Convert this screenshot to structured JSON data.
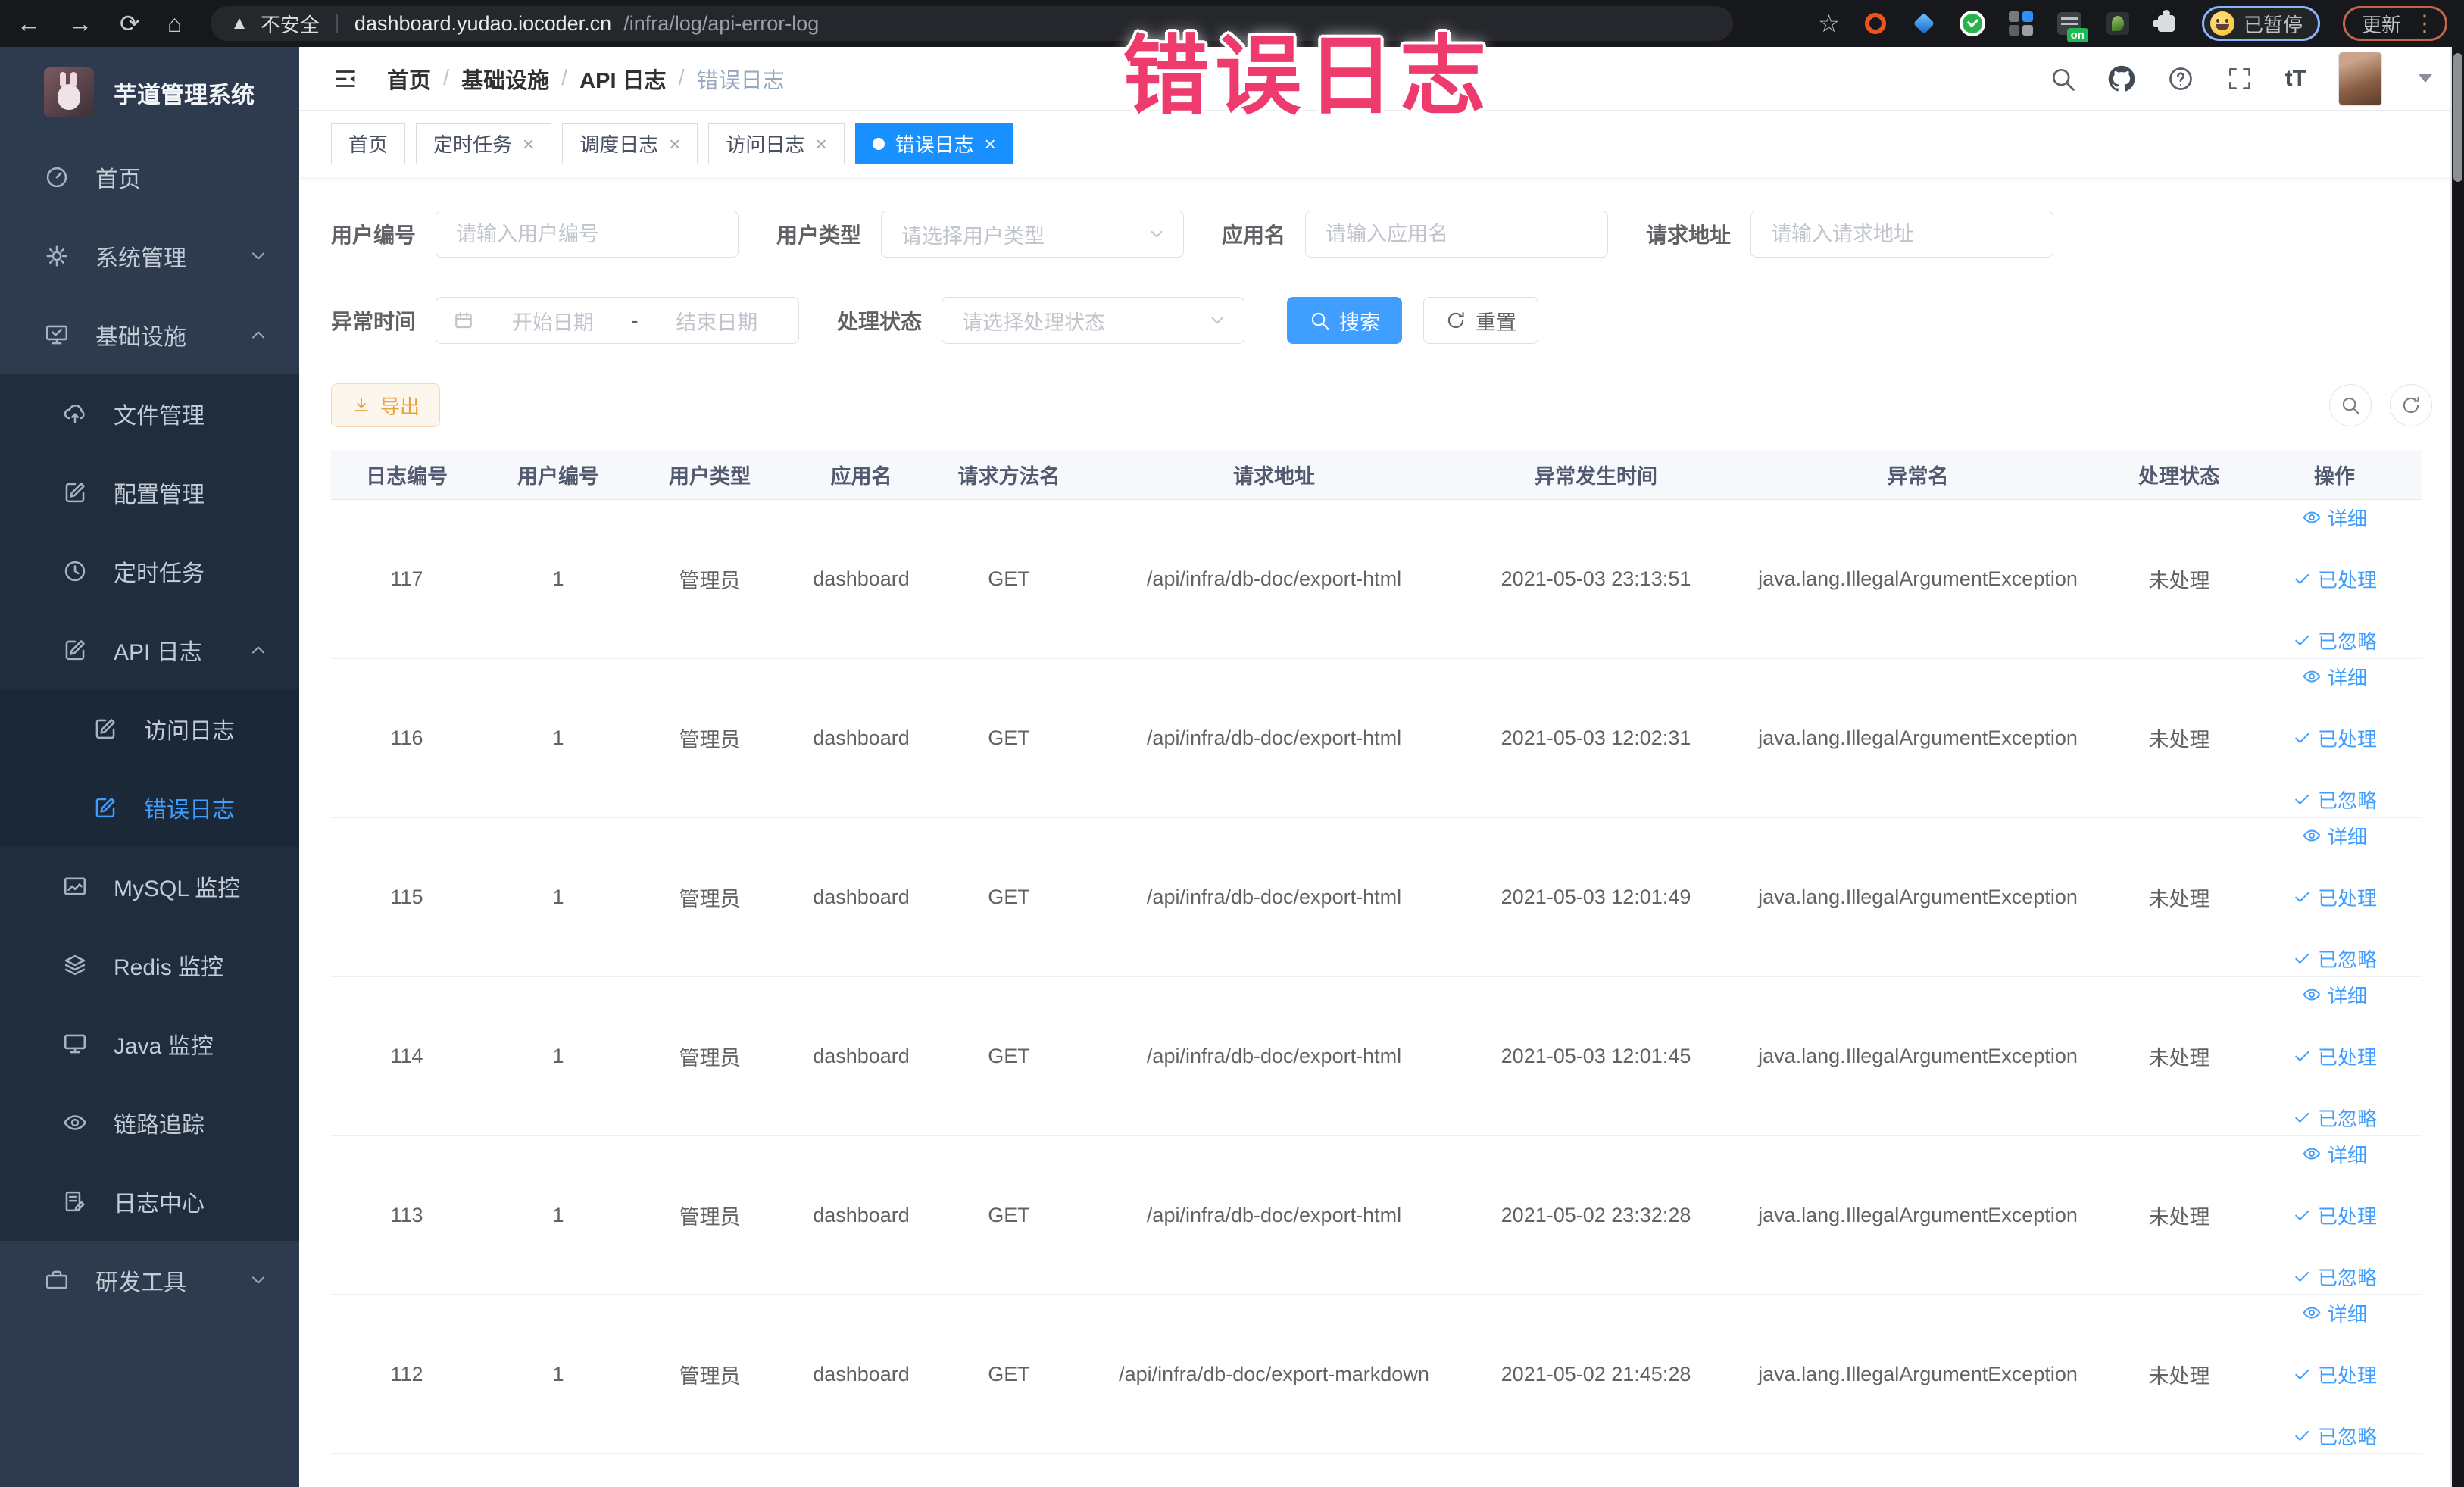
{
  "browser": {
    "security_label": "不安全",
    "url_host": "dashboard.yudao.iocoder.cn",
    "url_path": "/infra/log/api-error-log",
    "on_badge_label": "on",
    "paused_label": "已暂停",
    "update_label": "更新"
  },
  "overlay_title": "错误日志",
  "sidebar": {
    "title": "芋道管理系统",
    "items": [
      {
        "label": "首页"
      },
      {
        "label": "系统管理"
      },
      {
        "label": "基础设施"
      },
      {
        "label": "文件管理"
      },
      {
        "label": "配置管理"
      },
      {
        "label": "定时任务"
      },
      {
        "label": "API 日志"
      },
      {
        "label": "访问日志"
      },
      {
        "label": "错误日志"
      },
      {
        "label": "MySQL 监控"
      },
      {
        "label": "Redis 监控"
      },
      {
        "label": "Java 监控"
      },
      {
        "label": "链路追踪"
      },
      {
        "label": "日志中心"
      },
      {
        "label": "研发工具"
      }
    ]
  },
  "breadcrumb": {
    "items": [
      "首页",
      "基础设施",
      "API 日志",
      "错误日志"
    ]
  },
  "tabs": [
    {
      "label": "首页"
    },
    {
      "label": "定时任务"
    },
    {
      "label": "调度日志"
    },
    {
      "label": "访问日志"
    },
    {
      "label": "错误日志"
    }
  ],
  "filters": {
    "user_id_label": "用户编号",
    "user_id_placeholder": "请输入用户编号",
    "user_type_label": "用户类型",
    "user_type_placeholder": "请选择用户类型",
    "app_name_label": "应用名",
    "app_name_placeholder": "请输入应用名",
    "request_url_label": "请求地址",
    "request_url_placeholder": "请输入请求地址",
    "exception_time_label": "异常时间",
    "date_start_placeholder": "开始日期",
    "date_separator": "-",
    "date_end_placeholder": "结束日期",
    "process_status_label": "处理状态",
    "process_status_placeholder": "请选择处理状态",
    "search_label": "搜索",
    "reset_label": "重置"
  },
  "toolbar": {
    "export_label": "导出"
  },
  "table": {
    "headers": [
      "日志编号",
      "用户编号",
      "用户类型",
      "应用名",
      "请求方法名",
      "请求地址",
      "异常发生时间",
      "异常名",
      "处理状态",
      "操作"
    ],
    "action_labels": [
      "详细",
      "已处理",
      "已忽略"
    ],
    "rows": [
      {
        "id": "117",
        "user_id": "1",
        "user_type": "管理员",
        "app": "dashboard",
        "method": "GET",
        "url": "/api/infra/db-doc/export-html",
        "time": "2021-05-03 23:13:51",
        "exception": "java.lang.IllegalArgumentException",
        "status": "未处理"
      },
      {
        "id": "116",
        "user_id": "1",
        "user_type": "管理员",
        "app": "dashboard",
        "method": "GET",
        "url": "/api/infra/db-doc/export-html",
        "time": "2021-05-03 12:02:31",
        "exception": "java.lang.IllegalArgumentException",
        "status": "未处理"
      },
      {
        "id": "115",
        "user_id": "1",
        "user_type": "管理员",
        "app": "dashboard",
        "method": "GET",
        "url": "/api/infra/db-doc/export-html",
        "time": "2021-05-03 12:01:49",
        "exception": "java.lang.IllegalArgumentException",
        "status": "未处理"
      },
      {
        "id": "114",
        "user_id": "1",
        "user_type": "管理员",
        "app": "dashboard",
        "method": "GET",
        "url": "/api/infra/db-doc/export-html",
        "time": "2021-05-03 12:01:45",
        "exception": "java.lang.IllegalArgumentException",
        "status": "未处理"
      },
      {
        "id": "113",
        "user_id": "1",
        "user_type": "管理员",
        "app": "dashboard",
        "method": "GET",
        "url": "/api/infra/db-doc/export-html",
        "time": "2021-05-02 23:32:28",
        "exception": "java.lang.IllegalArgumentException",
        "status": "未处理"
      },
      {
        "id": "112",
        "user_id": "1",
        "user_type": "管理员",
        "app": "dashboard",
        "method": "GET",
        "url": "/api/infra/db-doc/export-markdown",
        "time": "2021-05-02 21:45:28",
        "exception": "java.lang.IllegalArgumentException",
        "status": "未处理"
      }
    ]
  },
  "colors": {
    "primary": "#409eff",
    "tab_active": "#1890ff",
    "warning": "#e6a23c",
    "sidebar_bg": "#2e3b4e",
    "submenu_bg": "#1f2d3d"
  }
}
